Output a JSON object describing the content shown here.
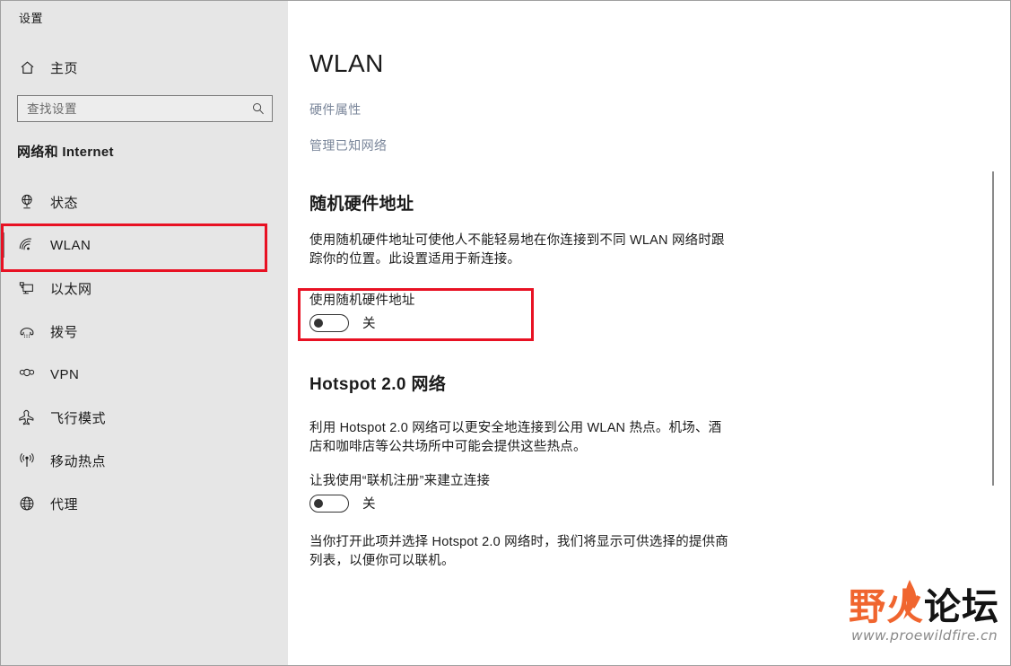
{
  "window": {
    "title": "设置",
    "controls": [
      {
        "name": "minimize",
        "glyph": "minimize-icon",
        "label": "—"
      },
      {
        "name": "maximize",
        "glyph": "maximize-icon",
        "label": "□"
      },
      {
        "name": "close",
        "glyph": "close-icon",
        "label": "✕"
      }
    ]
  },
  "sidebar": {
    "home": {
      "label": "主页",
      "icon": "home-icon"
    },
    "search": {
      "placeholder": "查找设置",
      "value": "",
      "icon": "search-icon"
    },
    "category": "网络和 Internet",
    "items": [
      {
        "label": "状态",
        "icon": "network-status-icon",
        "selected": false
      },
      {
        "label": "WLAN",
        "icon": "wifi-icon",
        "selected": true
      },
      {
        "label": "以太网",
        "icon": "ethernet-icon",
        "selected": false
      },
      {
        "label": "拨号",
        "icon": "dialup-phone-icon",
        "selected": false
      },
      {
        "label": "VPN",
        "icon": "vpn-icon",
        "selected": false
      },
      {
        "label": "飞行模式",
        "icon": "airplane-icon",
        "selected": false
      },
      {
        "label": "移动热点",
        "icon": "mobile-hotspot-icon",
        "selected": false
      },
      {
        "label": "代理",
        "icon": "proxy-globe-icon",
        "selected": false
      }
    ]
  },
  "content": {
    "page_title": "WLAN",
    "links": [
      {
        "label": "硬件属性"
      },
      {
        "label": "管理已知网络"
      }
    ],
    "sections": [
      {
        "heading": "随机硬件地址",
        "description": "使用随机硬件地址可使他人不能轻易地在你连接到不同 WLAN 网络时跟踪你的位置。此设置适用于新连接。",
        "toggle_label": "使用随机硬件地址",
        "toggle_state": "关",
        "toggle_on": false
      },
      {
        "heading": "Hotspot 2.0 网络",
        "description": "利用 Hotspot 2.0 网络可以更安全地连接到公用 WLAN 热点。机场、酒店和咖啡店等公共场所中可能会提供这些热点。",
        "toggle_label": "让我使用“联机注册”来建立连接",
        "toggle_state": "关",
        "toggle_on": false,
        "note": "当你打开此项并选择 Hotspot 2.0 网络时，我们将显示可供选择的提供商列表，以便你可以联机。"
      }
    ]
  },
  "annotations": {
    "highlight_color": "#e81123",
    "targets": [
      "sidebar-item-wlan",
      "random-hardware-address-toggle-group"
    ]
  },
  "watermark": {
    "text_orange": "野",
    "text_orange2": "火",
    "text_black": "论坛",
    "url": "www.proewildfire.cn",
    "color_orange": "#f0652f",
    "color_black": "#141414",
    "color_url": "#8a8a8a"
  }
}
